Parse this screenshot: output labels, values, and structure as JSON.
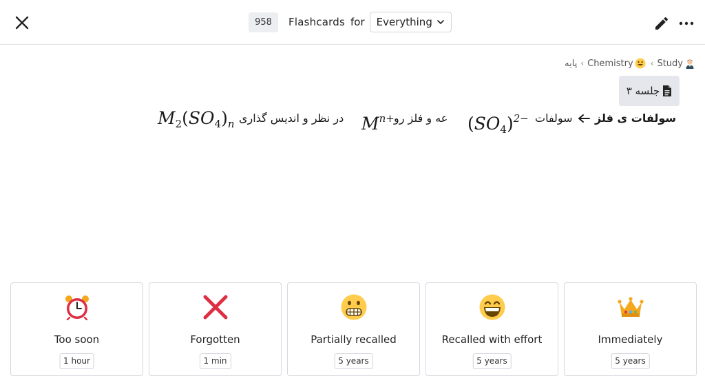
{
  "header": {
    "count": "958",
    "title": "Flashcards",
    "for": "for",
    "scope": "Everything"
  },
  "icons": {
    "close": "close-icon",
    "edit": "pencil-icon",
    "more": "more-dots-icon",
    "chevron": "chevron-down-icon",
    "document": "document-icon",
    "arrow": "arrow-left-icon"
  },
  "breadcrumb": {
    "items": [
      "Study",
      "Chemistry",
      "پایه"
    ],
    "separator": "‹"
  },
  "document": {
    "title": "جلسه ۳"
  },
  "card": {
    "term": "سولفات ی فلز",
    "word_sulfate": "سولفات",
    "math_sulfate": "(SO4)2−",
    "mid": "عه و فلز رو",
    "math_metal": "Mn+",
    "tail": "در نظر و اندیس گذاری",
    "math_formula": "M2(SO4)n"
  },
  "options": [
    {
      "label": "Too soon",
      "duration": "1 hour",
      "icon": "alarm-clock-icon"
    },
    {
      "label": "Forgotten",
      "duration": "1 min",
      "icon": "cross-mark-icon"
    },
    {
      "label": "Partially recalled",
      "duration": "5 years",
      "icon": "grimacing-face-icon"
    },
    {
      "label": "Recalled with effort",
      "duration": "5 years",
      "icon": "grinning-face-icon"
    },
    {
      "label": "Immediately",
      "duration": "5 years",
      "icon": "crown-icon"
    }
  ],
  "colors": {
    "border": "#d4d8dd",
    "badge_bg": "#eceef1",
    "chip_bg": "#e5e7ec",
    "cross": "#dd2e44",
    "emoji_yellow": "#ffcc4d",
    "alarm_red": "#dd2e44",
    "crown_gold": "#f4a81d"
  }
}
